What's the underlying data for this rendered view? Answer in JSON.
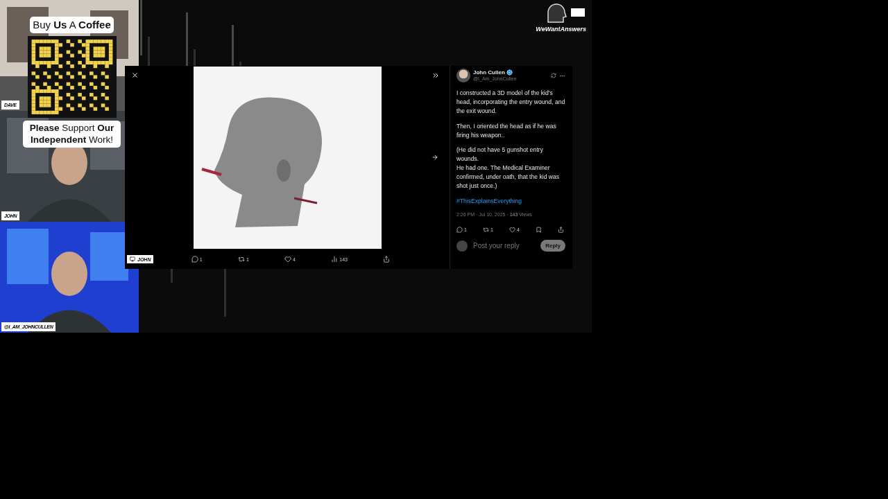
{
  "overlay": {
    "qr_title": "Buy **Us** A **Coffee**",
    "qr_caption": "**Please** Support **Our** **Independent** Work!",
    "brand": "WeWantAnswers"
  },
  "cams": [
    {
      "label": "DAVE",
      "kind": "room"
    },
    {
      "label": "JOHN",
      "kind": "studio"
    },
    {
      "label": "@I_AM_JOHNCULLEN",
      "kind": "blue"
    }
  ],
  "screen_label": "JOHN",
  "viewer": {
    "media_actions": [
      {
        "kind": "reply",
        "count": "1"
      },
      {
        "kind": "repost",
        "count": "1"
      },
      {
        "kind": "like",
        "count": "4"
      },
      {
        "kind": "views",
        "count": "143"
      },
      {
        "kind": "share"
      }
    ]
  },
  "post": {
    "author": "John Cullen",
    "handle": "@I_Am_JohnCullen",
    "verified": true,
    "paragraphs": [
      "I constructed a 3D model of the kid's head, incorporating the entry wound, and the exit wound.",
      "Then, I oriented the head as if he was firing his weapon..",
      "(He did not have 5 gunshot entry wounds.\nHe had one.  The Medical Examiner confirmed, under oath, that the kid was shot just once.)"
    ],
    "hashtag": "#ThisExplainsEverything",
    "time": "2:26 PM · Jul 10, 2025 · ",
    "views": "**143** Views",
    "actions": [
      {
        "kind": "reply",
        "count": "1"
      },
      {
        "kind": "repost",
        "count": "1"
      },
      {
        "kind": "like",
        "count": "4"
      },
      {
        "kind": "bookmark"
      },
      {
        "kind": "share"
      }
    ],
    "reply_placeholder": "Post your reply",
    "reply_button": "Reply"
  }
}
